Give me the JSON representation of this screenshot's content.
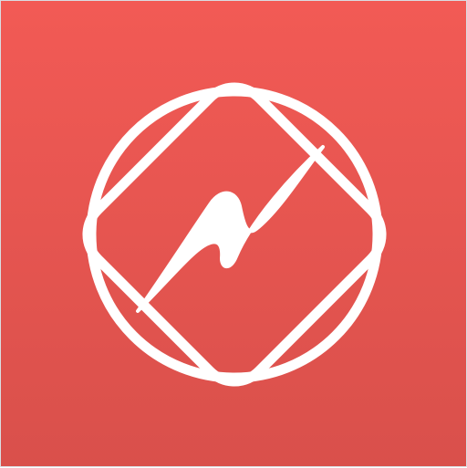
{
  "app_icon": {
    "icon_name": "lightning-compass-icon",
    "background_color_top": "#f25a55",
    "background_color_bottom": "#d9504b",
    "foreground_color": "#ffffff"
  }
}
